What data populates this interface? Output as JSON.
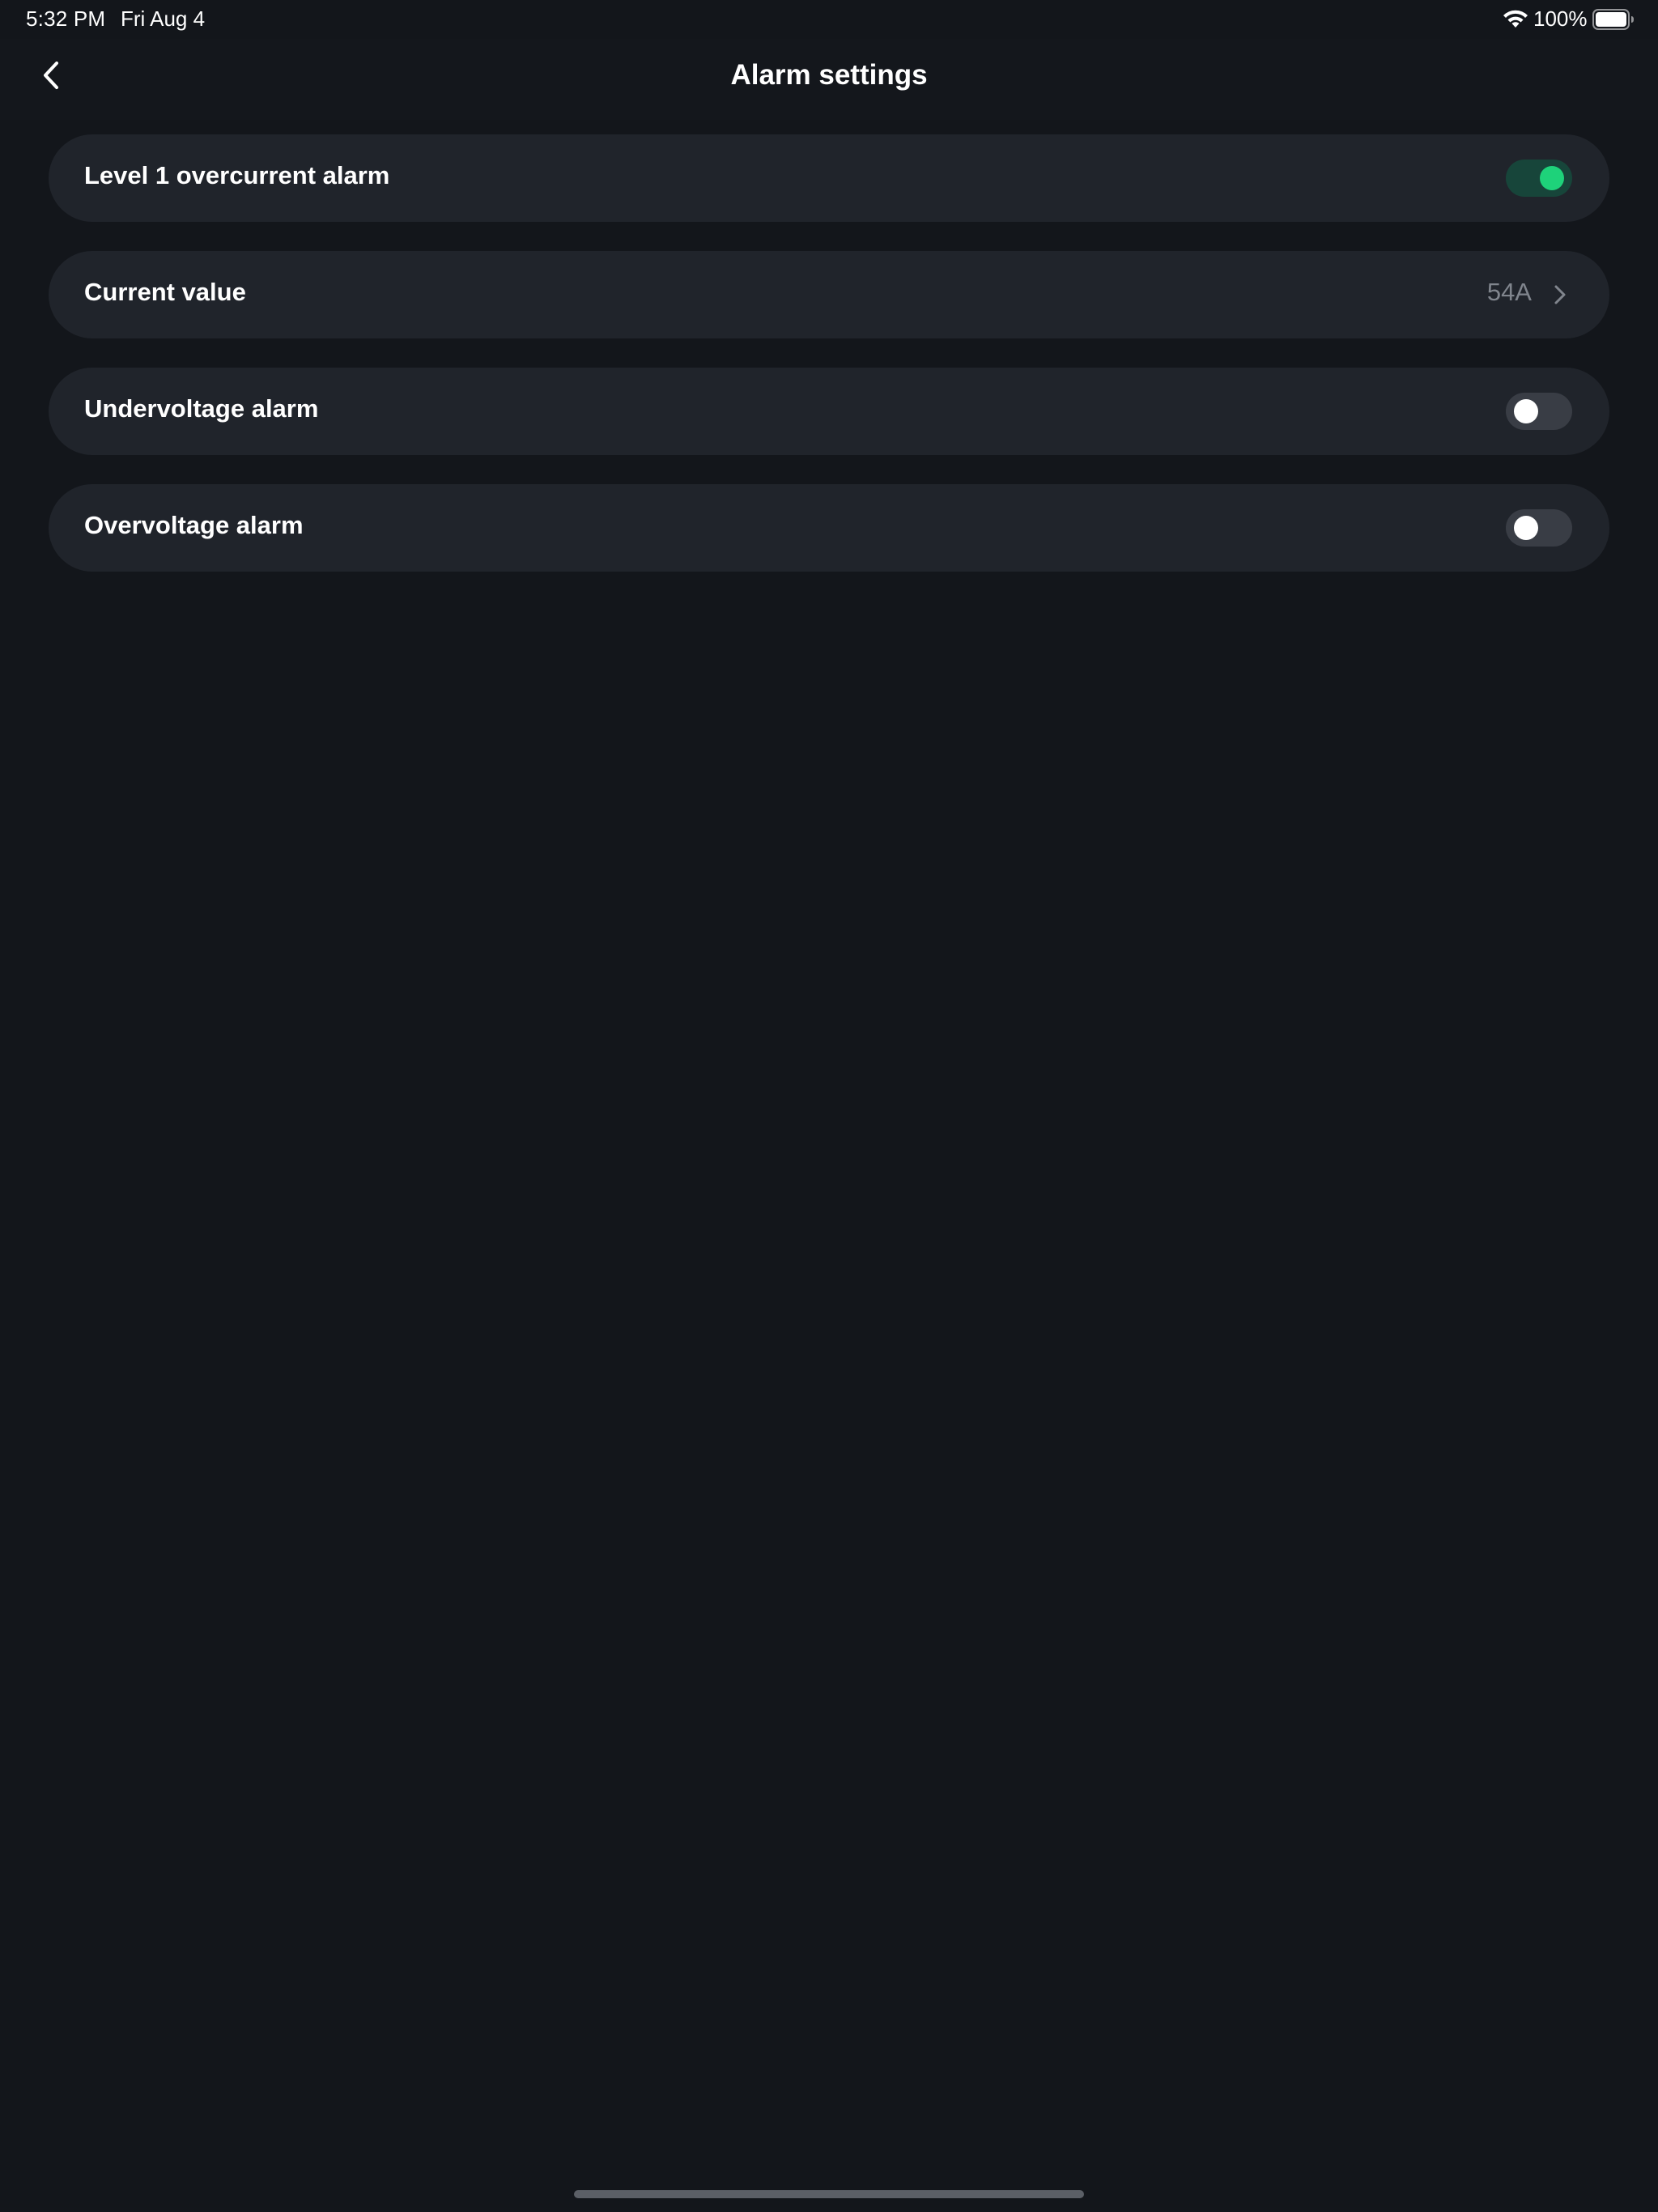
{
  "status_bar": {
    "time": "5:32 PM",
    "date": "Fri Aug 4",
    "battery_percent": "100%",
    "icons": [
      "wifi-icon",
      "battery-icon"
    ]
  },
  "header": {
    "title": "Alarm settings",
    "back_icon": "chevron-left-icon"
  },
  "settings": {
    "level1_overcurrent": {
      "label": "Level 1 overcurrent alarm",
      "enabled": true
    },
    "current_value": {
      "label": "Current value",
      "value": "54A",
      "icon": "chevron-right-icon"
    },
    "undervoltage": {
      "label": "Undervoltage alarm",
      "enabled": false
    },
    "overvoltage": {
      "label": "Overvoltage alarm",
      "enabled": false
    }
  },
  "colors": {
    "background": "#13161b",
    "card": "#20242b",
    "toggle_on_track": "#17453a",
    "toggle_on_knob": "#1ed27a",
    "toggle_off_track": "#393d45",
    "value_text": "#80858d"
  }
}
